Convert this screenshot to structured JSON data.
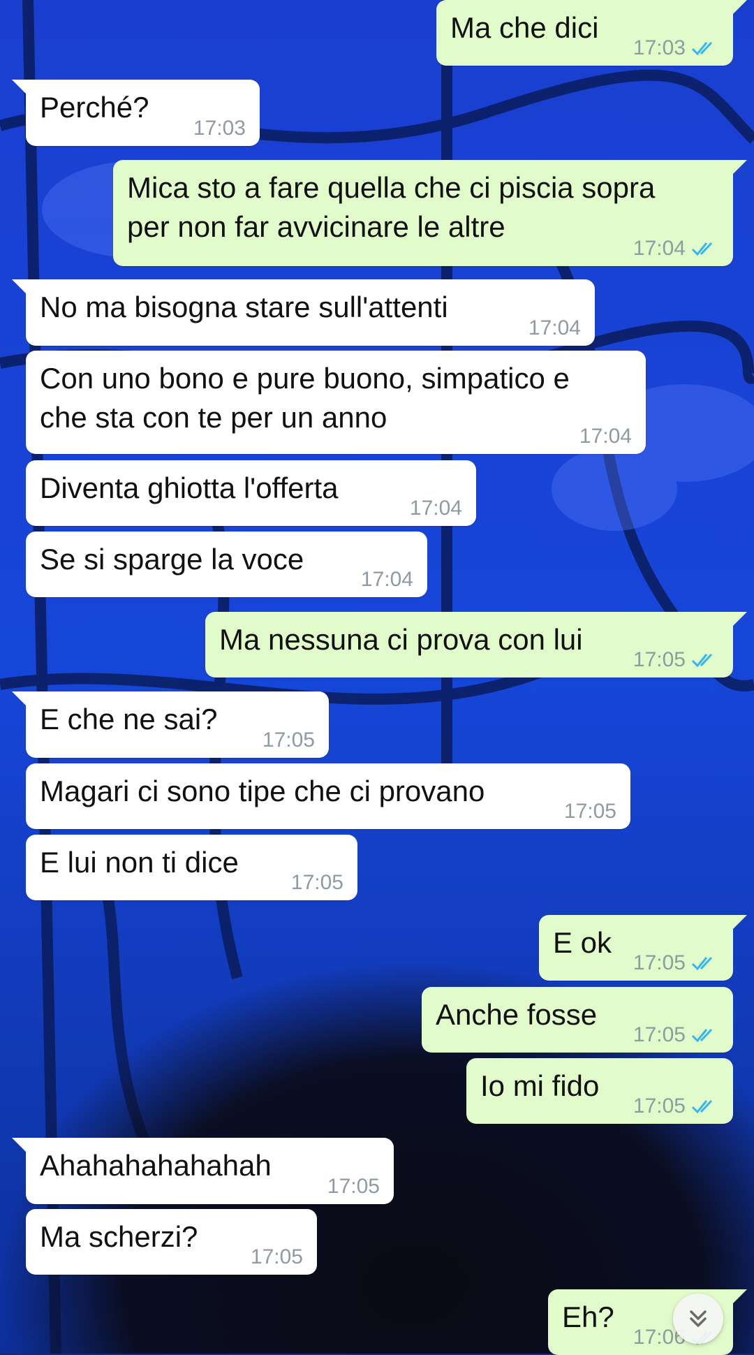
{
  "messages": [
    {
      "dir": "out",
      "tail": true,
      "text": "Ma che dici",
      "time": "17:03",
      "read": true
    },
    {
      "dir": "in",
      "tail": true,
      "text": "Perché?",
      "time": "17:03"
    },
    {
      "dir": "out",
      "tail": true,
      "text": "Mica sto a fare quella che ci piscia sopra\nper non far avvicinare le altre",
      "time": "17:04",
      "read": true
    },
    {
      "dir": "in",
      "tail": true,
      "text": "No ma bisogna stare sull'attenti",
      "time": "17:04"
    },
    {
      "dir": "in",
      "tail": false,
      "text": "Con uno bono e pure buono, simpatico e\nche sta con te per un anno",
      "time": "17:04"
    },
    {
      "dir": "in",
      "tail": false,
      "text": "Diventa ghiotta l'offerta",
      "time": "17:04"
    },
    {
      "dir": "in",
      "tail": false,
      "text": "Se si sparge la voce",
      "time": "17:04"
    },
    {
      "dir": "out",
      "tail": true,
      "text": "Ma nessuna ci prova con lui",
      "time": "17:05",
      "read": true
    },
    {
      "dir": "in",
      "tail": true,
      "text": "E che ne sai?",
      "time": "17:05"
    },
    {
      "dir": "in",
      "tail": false,
      "text": "Magari ci sono tipe che ci provano",
      "time": "17:05"
    },
    {
      "dir": "in",
      "tail": false,
      "text": "E lui non ti dice",
      "time": "17:05"
    },
    {
      "dir": "out",
      "tail": true,
      "text": "E ok",
      "time": "17:05",
      "read": true
    },
    {
      "dir": "out",
      "tail": false,
      "text": "Anche fosse",
      "time": "17:05",
      "read": true
    },
    {
      "dir": "out",
      "tail": false,
      "text": "Io mi fido",
      "time": "17:05",
      "read": true
    },
    {
      "dir": "in",
      "tail": true,
      "text": "Ahahahahahahah",
      "time": "17:05"
    },
    {
      "dir": "in",
      "tail": false,
      "text": "Ma scherzi?",
      "time": "17:05"
    },
    {
      "dir": "out",
      "tail": true,
      "text": "Eh?",
      "time": "17:06",
      "read": true
    }
  ],
  "scroll_button": {
    "icon": "double-chevron-down-icon"
  },
  "colors": {
    "incoming": "#ffffff",
    "outgoing": "#e2fbcb",
    "timestamp": "#8f9aa1",
    "read_ticks": "#34b7f1"
  }
}
